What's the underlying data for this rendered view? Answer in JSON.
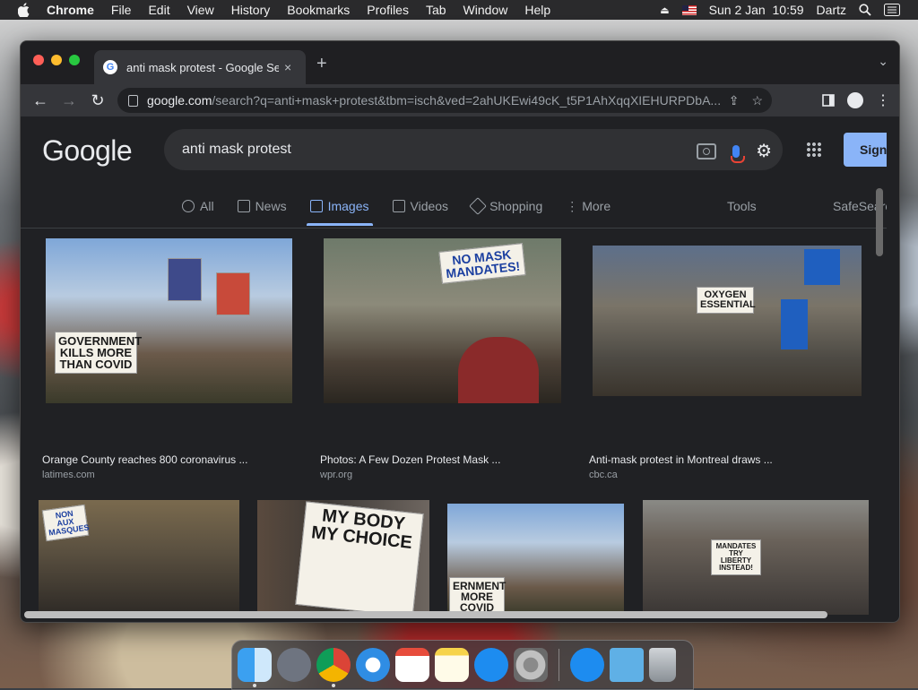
{
  "menubar": {
    "app": "Chrome",
    "items": [
      "File",
      "Edit",
      "View",
      "History",
      "Bookmarks",
      "Profiles",
      "Tab",
      "Window",
      "Help"
    ],
    "datetime": "Sun 2 Jan  10:59",
    "user": "Dartz"
  },
  "browser": {
    "tab_title": "anti mask protest - Google Sea",
    "url_domain": "google.com",
    "url_path": "/search?q=anti+mask+protest&tbm=isch&ved=2ahUKEwi49cK_t5P1AhXqqXIEHURPDbA...",
    "tab_close": "×",
    "new_tab": "+"
  },
  "google": {
    "logo": "Google",
    "query": "anti mask protest",
    "signin": "Sign",
    "tabs": [
      {
        "label": "All"
      },
      {
        "label": "News"
      },
      {
        "label": "Images"
      },
      {
        "label": "Videos"
      },
      {
        "label": "Shopping"
      },
      {
        "label": "More"
      }
    ],
    "tools": "Tools",
    "safesearch": "SafeSearch"
  },
  "results": [
    {
      "caption": "Orange County reaches 800 coronavirus ...",
      "source": "latimes.com",
      "sign": "GOVERNMENT KILLS MORE THAN COVID"
    },
    {
      "caption": "Photos: A Few Dozen Protest Mask ...",
      "source": "wpr.org",
      "sign": "NO MASK MANDATES!"
    },
    {
      "caption": "Anti-mask protest in Montreal draws ...",
      "source": "cbc.ca",
      "sign": "OXYGEN ESSENTIAL"
    },
    {
      "sign": "NON AUX MASQUES"
    },
    {
      "sign": "MY BODY MY CHOICE"
    },
    {
      "sign": "ERNMENT MORE COVID"
    },
    {
      "sign": "MANDATES TRY LIBERTY INSTEAD!"
    }
  ],
  "colors": {
    "accent": "#8ab4f8",
    "page_bg": "#202124",
    "searchbox_bg": "#303134"
  }
}
